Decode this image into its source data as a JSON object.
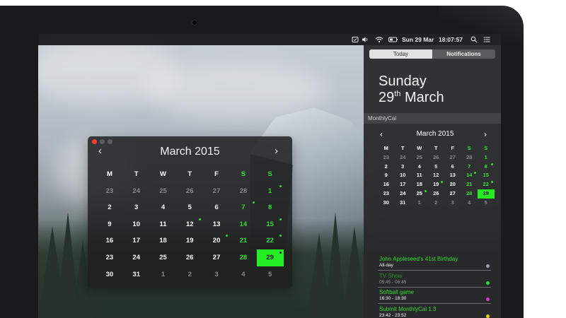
{
  "menubar": {
    "icons": [
      "monthlycal-icon",
      "volume-icon",
      "wifi-icon",
      "battery-icon",
      "search-icon",
      "notification-center-icon"
    ],
    "datetime": "Sun 29 Mar",
    "time": "18:07:57"
  },
  "notification_center": {
    "tabs": [
      {
        "label": "Today",
        "selected": true
      },
      {
        "label": "Notifications",
        "selected": false
      }
    ],
    "day_name": "Sunday",
    "date_number": "29",
    "date_suffix": "th",
    "date_month": "March",
    "widget_title": "MonthlyCal",
    "mini_calendar": {
      "month_label": "March 2015",
      "prev": "‹",
      "next": "›",
      "weekdays": [
        {
          "label": "M",
          "weekend": false
        },
        {
          "label": "T",
          "weekend": false
        },
        {
          "label": "W",
          "weekend": false
        },
        {
          "label": "T",
          "weekend": false
        },
        {
          "label": "F",
          "weekend": false
        },
        {
          "label": "S",
          "weekend": true
        },
        {
          "label": "S",
          "weekend": true
        }
      ],
      "days": [
        {
          "d": "23",
          "other": true
        },
        {
          "d": "24",
          "other": true
        },
        {
          "d": "25",
          "other": true
        },
        {
          "d": "26",
          "other": true
        },
        {
          "d": "27",
          "other": true
        },
        {
          "d": "28",
          "other": true
        },
        {
          "d": "1",
          "weekend": true
        },
        {
          "d": "2"
        },
        {
          "d": "3"
        },
        {
          "d": "4"
        },
        {
          "d": "5"
        },
        {
          "d": "6"
        },
        {
          "d": "7",
          "weekend": true
        },
        {
          "d": "8",
          "weekend": true,
          "dot": "#33dd33"
        },
        {
          "d": "9"
        },
        {
          "d": "10"
        },
        {
          "d": "11"
        },
        {
          "d": "12"
        },
        {
          "d": "13"
        },
        {
          "d": "14",
          "weekend": true,
          "dot": "#33dd33"
        },
        {
          "d": "15",
          "weekend": true
        },
        {
          "d": "16"
        },
        {
          "d": "17"
        },
        {
          "d": "18"
        },
        {
          "d": "19",
          "dot": "#33dd33"
        },
        {
          "d": "20"
        },
        {
          "d": "21",
          "weekend": true
        },
        {
          "d": "22",
          "weekend": true,
          "dot": "#33dd33"
        },
        {
          "d": "23"
        },
        {
          "d": "24"
        },
        {
          "d": "25",
          "dot": "#33dd33"
        },
        {
          "d": "26"
        },
        {
          "d": "27"
        },
        {
          "d": "28",
          "weekend": true
        },
        {
          "d": "29",
          "weekend": true,
          "today": true
        },
        {
          "d": "30"
        },
        {
          "d": "31"
        },
        {
          "d": "1",
          "other": true
        },
        {
          "d": "2",
          "other": true
        },
        {
          "d": "3",
          "other": true
        },
        {
          "d": "4",
          "other": true
        },
        {
          "d": "5",
          "other": true
        }
      ]
    },
    "events": [
      {
        "title": "John Appleseed's 41st Birthday",
        "time": "All-day",
        "color": "#33dd33",
        "dot": "#9aa3b2",
        "dim": false
      },
      {
        "title": "TV Show",
        "time": "05:45 - 06:45",
        "color": "#2f8f2f",
        "dot": "#33dd33",
        "dim": true
      },
      {
        "title": "Softball game",
        "time": "16:30 - 18:30",
        "color": "#33dd33",
        "dot": "#d63bd6",
        "dim": false
      },
      {
        "title": "Submit MonthlyCal 1.3",
        "time": "23:42 - 23:52",
        "color": "#33dd33",
        "dot": "#f0d000",
        "dim": false
      }
    ]
  },
  "calendar_window": {
    "month_label": "March 2015",
    "prev": "‹",
    "next": "›",
    "weekdays": [
      {
        "label": "M",
        "weekend": false
      },
      {
        "label": "T",
        "weekend": false
      },
      {
        "label": "W",
        "weekend": false
      },
      {
        "label": "T",
        "weekend": false
      },
      {
        "label": "F",
        "weekend": false
      },
      {
        "label": "S",
        "weekend": true
      },
      {
        "label": "S",
        "weekend": true
      }
    ],
    "days": [
      {
        "d": "23",
        "other": true
      },
      {
        "d": "24",
        "other": true
      },
      {
        "d": "25",
        "other": true
      },
      {
        "d": "26",
        "other": true
      },
      {
        "d": "27",
        "other": true
      },
      {
        "d": "28",
        "other": true
      },
      {
        "d": "1",
        "weekend": true,
        "dot": "#33dd33"
      },
      {
        "d": "2"
      },
      {
        "d": "3"
      },
      {
        "d": "4"
      },
      {
        "d": "5"
      },
      {
        "d": "6"
      },
      {
        "d": "7",
        "weekend": true,
        "dot": "#33dd33"
      },
      {
        "d": "8",
        "weekend": true
      },
      {
        "d": "9"
      },
      {
        "d": "10"
      },
      {
        "d": "11"
      },
      {
        "d": "12",
        "dot": "#33dd33"
      },
      {
        "d": "13"
      },
      {
        "d": "14",
        "weekend": true
      },
      {
        "d": "15",
        "weekend": true,
        "dot": "#33dd33"
      },
      {
        "d": "16"
      },
      {
        "d": "17"
      },
      {
        "d": "18"
      },
      {
        "d": "19"
      },
      {
        "d": "20",
        "dot": "#33dd33"
      },
      {
        "d": "21",
        "weekend": true
      },
      {
        "d": "22",
        "weekend": true,
        "dot": "#33dd33"
      },
      {
        "d": "23"
      },
      {
        "d": "24"
      },
      {
        "d": "25"
      },
      {
        "d": "26"
      },
      {
        "d": "27"
      },
      {
        "d": "28",
        "weekend": true
      },
      {
        "d": "29",
        "weekend": true,
        "today": true,
        "dot": "#33dd33"
      },
      {
        "d": "30"
      },
      {
        "d": "31"
      },
      {
        "d": "1",
        "other": true
      },
      {
        "d": "2",
        "other": true
      },
      {
        "d": "3",
        "other": true
      },
      {
        "d": "4",
        "other": true
      },
      {
        "d": "5",
        "other": true
      }
    ]
  },
  "colors": {
    "accent_green": "#33dd33",
    "today_bg": "#22ee22",
    "other_month": "#8a8a8c",
    "close_button": "#ff3b30"
  }
}
